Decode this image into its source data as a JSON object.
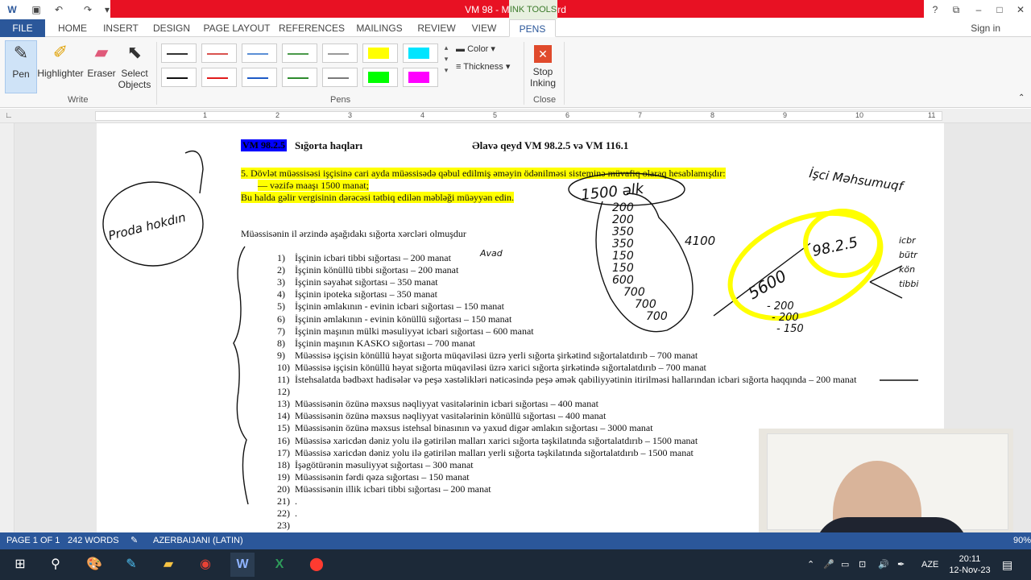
{
  "window": {
    "title": "VM 98 -  Microsoft Word",
    "ink_tools_label": "INK TOOLS",
    "sign_in": "Sign in"
  },
  "tabs": [
    "FILE",
    "HOME",
    "INSERT",
    "DESIGN",
    "PAGE LAYOUT",
    "REFERENCES",
    "MAILINGS",
    "REVIEW",
    "VIEW",
    "PENS"
  ],
  "ribbon": {
    "write": {
      "pen": "Pen",
      "highlighter": "Highlighter",
      "eraser": "Eraser",
      "select": "Select Objects",
      "group": "Write"
    },
    "pens_group": "Pens",
    "pen_colors": [
      "#333333",
      "#d9534f",
      "#5b8fd6",
      "#4a9a4a",
      "#999999",
      "#ffff00",
      "#00e5ff",
      "#111111",
      "#e01b1b",
      "#1e5bc6",
      "#2e8b2e",
      "#7a7a7a",
      "#00ff00",
      "#ff00ff"
    ],
    "color_label": "Color",
    "thickness_label": "Thickness",
    "stop_inking": "Stop Inking",
    "close_group": "Close"
  },
  "ruler_numbers": [
    "1",
    "2",
    "3",
    "4",
    "5",
    "6",
    "7",
    "8",
    "9",
    "10",
    "11"
  ],
  "document": {
    "vm_tag": "VM 98.2.5",
    "heading": "Sığorta haqları",
    "note": "Əlavə qeyd VM 98.2.5 və VM 116.1",
    "highlight_lines": [
      "5.  Dövlət müəssisəsi işçisinə cari ayda müəssisədə qəbul edilmiş əməyin ödənilməsi sisteminə müvafiq olaraq hesablamışdır:",
      "—     vəzifə maaşı 1500 manat;",
      "Bu halda gəlir vergisinin dərəcəsi tətbiq edilən məbləği müəyyən edin."
    ],
    "intro": "Müəssisənin il ərzində aşağıdakı sığorta xərcləri olmuşdur",
    "items": [
      {
        "n": "1)",
        "t": "İşçinin icbari tibbi sığortası – 200 manat"
      },
      {
        "n": "2)",
        "t": "İşçinin könüllü tibbi sığortası – 200 manat"
      },
      {
        "n": "3)",
        "t": "İşçinin səyahət sığortası – 350 manat"
      },
      {
        "n": "4)",
        "t": "İşçinin ipoteka sığortası – 350 manat"
      },
      {
        "n": "5)",
        "t": "İşçinin əmlakının - evinin icbari sığortası – 150 manat"
      },
      {
        "n": "6)",
        "t": "İşçinin əmlakının - evinin könüllü sığortası – 150 manat"
      },
      {
        "n": "7)",
        "t": "İşçinin maşının mülki məsuliyyət icbari sığortası – 600 manat"
      },
      {
        "n": "8)",
        "t": "İşçinin maşının KASKO sığortası – 700 manat"
      },
      {
        "n": "9)",
        "t": "Müəssisə işçisin könüllü həyat sığorta müqaviləsi üzrə yerli sığorta şirkətind sığortalatdırıb – 700 manat"
      },
      {
        "n": "10)",
        "t": "Müəssisə işçisin könüllü həyat sığorta müqaviləsi üzrə xarici sığorta şirkətində sığortalatdırıb – 700 manat"
      },
      {
        "n": "11)",
        "t": "İstehsalatda bədbəxt hadisələr və peşə xəstəlikləri nəticəsində peşə əmək qabiliyyətinin itirilməsi hallarından icbari sığorta haqqında – 200 manat"
      },
      {
        "n": "12)",
        "t": ""
      },
      {
        "n": "13)",
        "t": "Müəssisənin özünə məxsus nəqliyyat vasitələrinin icbari sığortası – 400 manat"
      },
      {
        "n": "14)",
        "t": "Müəssisənin özünə məxsus nəqliyyat vasitələrinin könüllü sığortası – 400 manat"
      },
      {
        "n": "15)",
        "t": "Müəssisənin özünə məxsus istehsal binasının və yaxud digər əmlakın sığortası – 3000 manat"
      },
      {
        "n": "16)",
        "t": "Müəssisə xaricdən dəniz yolu ilə gətirilən malları xarici sığorta təşkilatında sığortalatdırıb – 1500 manat"
      },
      {
        "n": "17)",
        "t": "Müəssisə xaricdən dəniz yolu ilə gətirilən malları yerli sığorta təşkilatında sığortalatdırıb – 1500 manat"
      },
      {
        "n": "18)",
        "t": "İşəgötürənin məsuliyyət sığortası – 300 manat"
      },
      {
        "n": "19)",
        "t": "Müəssisənin fərdi qəza sığortası – 150 manat"
      },
      {
        "n": "20)",
        "t": "Müəssisənin illik icbari tibbi sığortası – 200 manat"
      },
      {
        "n": "21)",
        "t": "."
      },
      {
        "n": "22)",
        "t": "."
      },
      {
        "n": "23)",
        "t": ""
      }
    ]
  },
  "ink": {
    "left_note": "Proda hokdın",
    "right_note": "İşci Məhsumuqf",
    "salary": "1500 əlk",
    "column": [
      "200",
      "200",
      "350",
      "350",
      "150",
      "150",
      "600",
      "700",
      "700",
      "700"
    ],
    "sum": "4100",
    "result": "5600",
    "minus": [
      "- 200",
      "- 200",
      "- 150"
    ],
    "circled": "98.2.5",
    "side": [
      "icbr",
      "bütr",
      "kön",
      "tibbi"
    ],
    "avad": "Avad"
  },
  "status": {
    "page": "PAGE 1 OF 1",
    "words": "242 WORDS",
    "language": "AZERBAIJANI (LATIN)",
    "zoom": "90%"
  },
  "taskbar": {
    "lang": "AZE",
    "time": "20:11",
    "date": "12-Nov-23"
  }
}
